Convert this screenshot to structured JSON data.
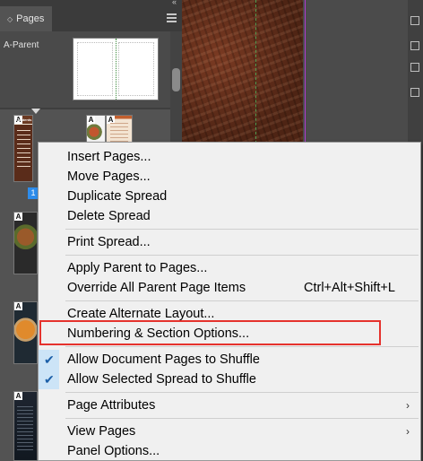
{
  "panel": {
    "tab_label": "Pages",
    "parent_label": "A-Parent",
    "page_number": "1",
    "contents_thumb_title": "Contents",
    "parent_letter": "A"
  },
  "menu": {
    "items": [
      {
        "label": "Insert Pages..."
      },
      {
        "label": "Move Pages..."
      },
      {
        "label": "Duplicate Spread"
      },
      {
        "label": "Delete Spread"
      },
      {
        "label": "Print Spread..."
      },
      {
        "label": "Apply Parent to Pages..."
      },
      {
        "label": "Override All Parent Page Items",
        "shortcut": "Ctrl+Alt+Shift+L"
      },
      {
        "label": "Create Alternate Layout..."
      },
      {
        "label": "Numbering & Section Options..."
      },
      {
        "label": "Allow Document Pages to Shuffle",
        "checked": true
      },
      {
        "label": "Allow Selected Spread to Shuffle",
        "checked": true
      },
      {
        "label": "Page Attributes",
        "submenu": true
      },
      {
        "label": "View Pages",
        "submenu": true
      },
      {
        "label": "Panel Options..."
      }
    ],
    "checkmark_glyph": "✔",
    "submenu_glyph": "›",
    "highlighted_item": "Numbering & Section Options..."
  },
  "colors": {
    "highlight_border": "#e5322d",
    "page_number_badge": "#2d8ceb",
    "menu_background": "#f0f0f0",
    "check_background": "#cce4f7"
  }
}
